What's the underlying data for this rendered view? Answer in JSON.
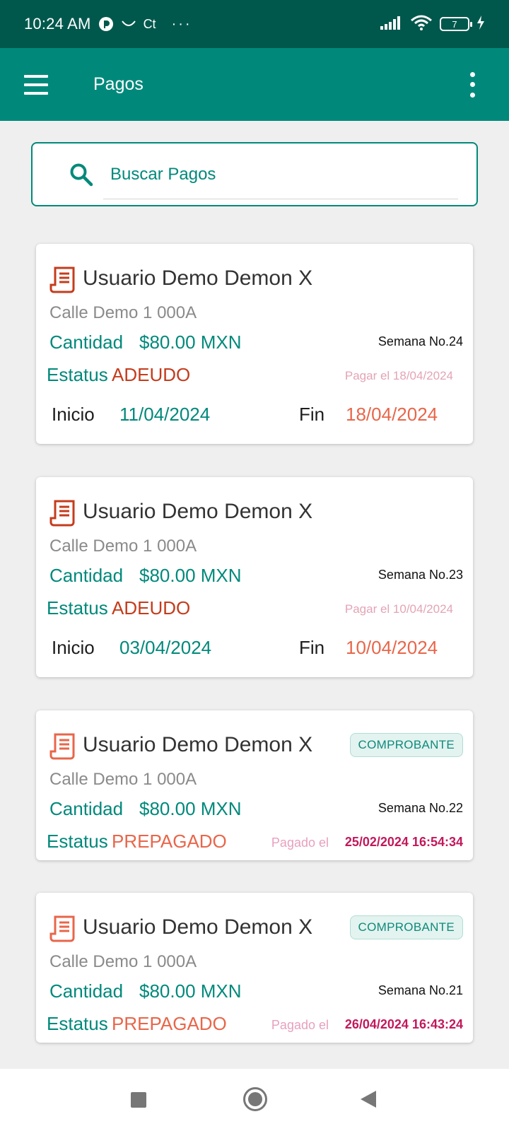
{
  "status_bar": {
    "time": "10:24 AM",
    "carrier_glyph": "Ct",
    "more_glyph": "···",
    "battery_level": "7"
  },
  "app_bar": {
    "title": "Pagos",
    "menu_icon": "hamburger-menu-icon",
    "more_icon": "more-vert-icon"
  },
  "search": {
    "placeholder": "Buscar Pagos"
  },
  "colors": {
    "primary": "#00897b",
    "primary_dark": "#00584d",
    "adeudo": "#c43c1c",
    "prepagado": "#e8664a",
    "pagado_fecha": "#c2185b"
  },
  "cards": [
    {
      "name": "Usuario Demo Demon X",
      "address": "Calle Demo 1 000A",
      "cantidad_label": "Cantidad",
      "cantidad": "$80.00 MXN",
      "semana": "Semana No.24",
      "estatus_label": "Estatus",
      "estatus": "ADEUDO",
      "pagar_el": "Pagar el 18/04/2024",
      "inicio_label": "Inicio",
      "inicio": "11/04/2024",
      "fin_label": "Fin",
      "fin": "18/04/2024"
    },
    {
      "name": "Usuario Demo Demon X",
      "address": "Calle Demo 1 000A",
      "cantidad_label": "Cantidad",
      "cantidad": "$80.00 MXN",
      "semana": "Semana No.23",
      "estatus_label": "Estatus",
      "estatus": "ADEUDO",
      "pagar_el": "Pagar el 10/04/2024",
      "inicio_label": "Inicio",
      "inicio": "03/04/2024",
      "fin_label": "Fin",
      "fin": "10/04/2024"
    },
    {
      "name": "Usuario Demo Demon X",
      "address": "Calle Demo 1 000A",
      "cantidad_label": "Cantidad",
      "cantidad": "$80.00 MXN",
      "semana": "Semana No.22",
      "estatus_label": "Estatus",
      "estatus": "PREPAGADO",
      "chip": "COMPROBANTE",
      "pagado_label": "Pagado el",
      "pagado_fecha": "25/02/2024 16:54:34"
    },
    {
      "name": "Usuario Demo Demon X",
      "address": "Calle Demo 1 000A",
      "cantidad_label": "Cantidad",
      "cantidad": "$80.00 MXN",
      "semana": "Semana No.21",
      "estatus_label": "Estatus",
      "estatus": "PREPAGADO",
      "chip": "COMPROBANTE",
      "pagado_label": "Pagado el",
      "pagado_fecha": "26/04/2024 16:43:24"
    }
  ],
  "nav_bar": {
    "recents_icon": "recents-square-icon",
    "home_icon": "home-circle-icon",
    "back_icon": "back-triangle-icon"
  }
}
